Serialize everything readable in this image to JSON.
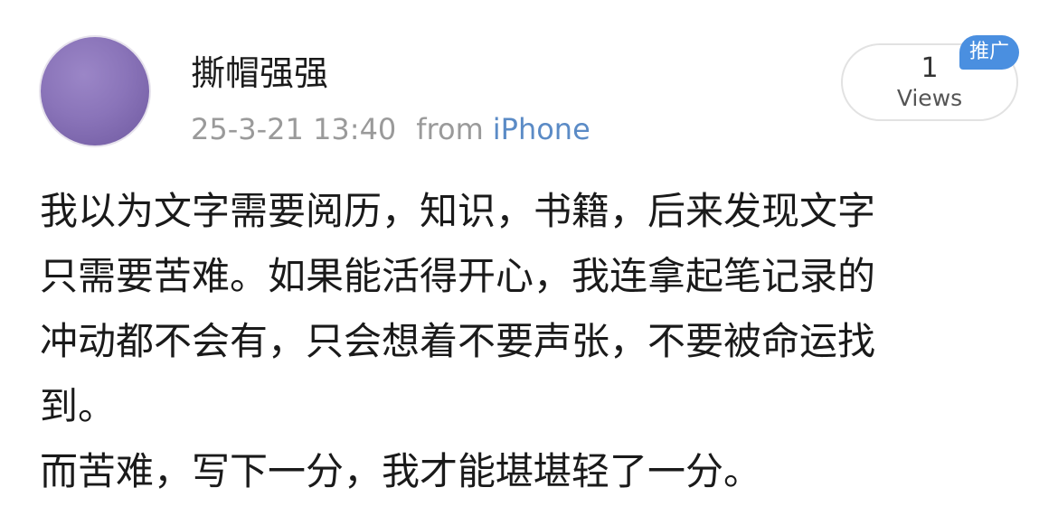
{
  "post": {
    "username": "撕帽强强",
    "time": "25-3-21 13:40",
    "from_label": "from",
    "device": "iPhone",
    "views_count": "1",
    "views_label": "Views",
    "promo_badge": "推广",
    "lines": [
      "我以为文字需要阅历，知识，书籍，后来发现文字",
      "只需要苦难。如果能活得开心，我连拿起笔记录的",
      "冲动都不会有，只会想着不要声张，不要被命运找",
      "到。",
      "而苦难，写下一分，我才能堪堪轻了一分。"
    ]
  },
  "colors": {
    "text": "#1a1a1a",
    "meta": "#9a9a9a",
    "link": "#5b8bc6",
    "badge": "#4a8fe0",
    "avatar": "#8a74b9"
  }
}
